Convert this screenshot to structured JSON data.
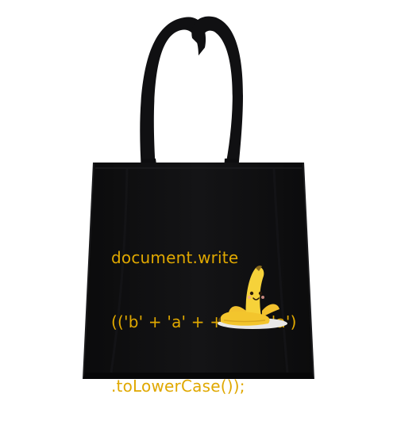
{
  "product": {
    "print": {
      "text_color": "#e0a800",
      "lines": [
        "document.write",
        "(('b' + 'a' + + 'a' + 'a')",
        ".toLowerCase());"
      ]
    },
    "bag_color": "#0f0f10",
    "illustration": "banana-icon"
  }
}
